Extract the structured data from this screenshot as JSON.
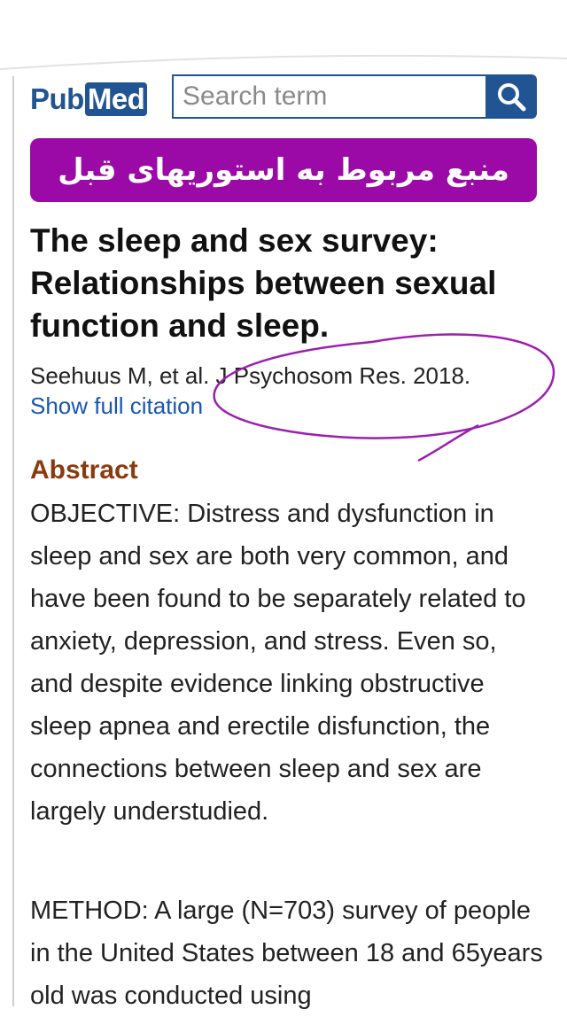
{
  "header": {
    "logo_pub": "Pub",
    "logo_med": "Med",
    "search": {
      "placeholder": "Search term",
      "value": ""
    }
  },
  "banner": {
    "text": "منبع مربوط به استوریهای قبل"
  },
  "article": {
    "title": "The sleep and sex survey: Relationships between sexual function and sleep.",
    "citation": "Seehuus M, et al. J Psychosom Res. 2018.",
    "show_full_citation": "Show full citation"
  },
  "abstract": {
    "heading": "Abstract",
    "paragraphs": [
      "OBJECTIVE: Distress and dysfunction in sleep and sex are both very common, and have been found to be separately related to anxiety, depression, and stress. Even so, and despite evidence linking obstructive sleep apnea and erectile disfunction, the connections between sleep and sex are largely understudied.",
      "METHOD: A large (N=703) survey of people in the United States between 18 and 65years old was conducted using"
    ]
  },
  "colors": {
    "brand": "#205493",
    "banner": "#9b0aa7",
    "link": "#1a56b0",
    "abstract_heading": "#8b3a0e",
    "annotation": "#9b1fb0"
  },
  "icons": {
    "search_button": "magnifier-icon"
  }
}
